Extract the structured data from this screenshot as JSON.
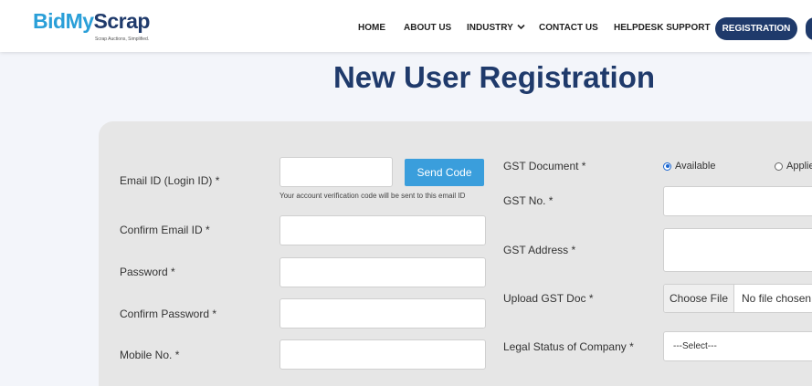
{
  "logo": {
    "part1": "Bid",
    "part2": "My",
    "part3": "Scrap",
    "tagline": "Scrap Auctions, Simplified."
  },
  "nav": {
    "home": "HOME",
    "about": "ABOUT US",
    "industry": "INDUSTRY",
    "contact": "CONTACT US",
    "helpdesk": "HELPDESK SUPPORT",
    "registration": "REGISTRATION"
  },
  "page": {
    "title": "New User Registration"
  },
  "form": {
    "email_label": "Email ID (Login ID) *",
    "email_value": "",
    "send_code": "Send Code",
    "email_hint": "Your account verification code will be sent to this email ID",
    "confirm_email_label": "Confirm Email ID *",
    "password_label": "Password *",
    "confirm_password_label": "Confirm Password *",
    "mobile_label": "Mobile No. *",
    "gst_document_label": "GST Document *",
    "gst_available": "Available",
    "gst_applied": "Applied",
    "gst_no_label": "GST No. *",
    "gst_address_label": "GST Address *",
    "upload_gst_label": "Upload GST Doc *",
    "choose_file": "Choose File",
    "no_file": "No file chosen",
    "legal_status_label": "Legal Status of Company *",
    "legal_status_value": "---Select---"
  },
  "colors": {
    "brand_dark": "#1f3a6b",
    "brand_light": "#2a9fd8",
    "button": "#3a9edc"
  }
}
